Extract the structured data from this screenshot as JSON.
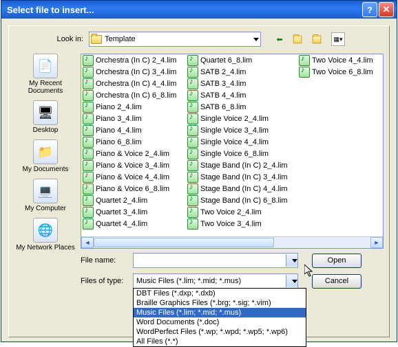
{
  "window": {
    "title": "Select file to insert..."
  },
  "lookin": {
    "label": "Look in:",
    "value": "Template"
  },
  "places": [
    {
      "label": "My Recent Documents",
      "icon": "📄"
    },
    {
      "label": "Desktop",
      "icon": "🖥"
    },
    {
      "label": "My Documents",
      "icon": "📁"
    },
    {
      "label": "My Computer",
      "icon": "💻"
    },
    {
      "label": "My Network Places",
      "icon": "🌐"
    }
  ],
  "files_col1": [
    "Orchestra (In C) 2_4.lim",
    "Orchestra (In C) 3_4.lim",
    "Orchestra (In C) 4_4.lim",
    "Orchestra (In C) 6_8.lim",
    "Piano 2_4.lim",
    "Piano 3_4.lim",
    "Piano 4_4.lim",
    "Piano 6_8.lim",
    "Piano & Voice 2_4.lim",
    "Piano & Voice 3_4.lim",
    "Piano & Voice 4_4.lim",
    "Piano & Voice 6_8.lim",
    "Quartet 2_4.lim",
    "Quartet 3_4.lim",
    "Quartet 4_4.lim"
  ],
  "files_col2": [
    "Quartet 6_8.lim",
    "SATB 2_4.lim",
    "SATB 3_4.lim",
    "SATB 4_4.lim",
    "SATB 6_8.lim",
    "Single Voice 2_4.lim",
    "Single Voice 3_4.lim",
    "Single Voice 4_4.lim",
    "Single Voice 6_8.lim",
    "Stage Band (In C) 2_4.lim",
    "Stage Band (In C) 3_4.lim",
    "Stage Band (In C) 4_4.lim",
    "Stage Band (In C) 6_8.lim",
    "Two Voice 2_4.lim",
    "Two Voice 3_4.lim"
  ],
  "files_col3": [
    "Two Voice 4_4.lim",
    "Two Voice 6_8.lim"
  ],
  "filename": {
    "label": "File name:",
    "value": ""
  },
  "filetype": {
    "label": "Files of type:",
    "value": "Music Files (*.lim; *.mid; *.mus)",
    "options": [
      "DBT Files (*.dxp; *.dxb)",
      "Braille Graphics Files (*.brg; *.sig; *.vim)",
      "Music Files (*.lim; *.mid; *.mus)",
      "Word Documents (*.doc)",
      "WordPerfect Files (*.wp; *.wpd; *.wp5; *.wp6)",
      "All Files (*.*)"
    ],
    "selected_index": 2
  },
  "buttons": {
    "open": "Open",
    "cancel": "Cancel"
  }
}
